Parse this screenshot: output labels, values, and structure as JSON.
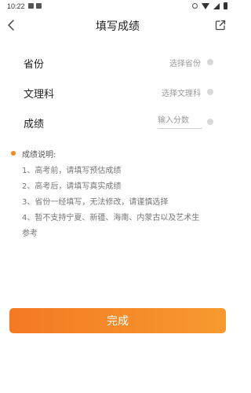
{
  "status_bar": {
    "time": "10:22"
  },
  "header": {
    "title": "填写成绩",
    "back_icon": "back-arrow-icon",
    "share_icon": "share-icon"
  },
  "form": {
    "province": {
      "label": "省份",
      "value": "选择省份"
    },
    "subject": {
      "label": "文理科",
      "value": "选择文理科"
    },
    "score": {
      "label": "成绩",
      "value": "",
      "placeholder": "输入分数"
    }
  },
  "notes": {
    "title": "成绩说明:",
    "lines": [
      "1、高考前，请填写预估成绩",
      "2、高考后，请填写真实成绩",
      "3、省份一经填写，无法修改，请谨慎选择",
      "4、暂不支持宁夏、新疆、海南、内蒙古以及艺术生",
      "参考"
    ]
  },
  "actions": {
    "done_label": "完成"
  },
  "colors": {
    "accent": "#F58A1F",
    "button_gradient_start": "#F47A22",
    "button_gradient_end": "#F69A2F"
  }
}
